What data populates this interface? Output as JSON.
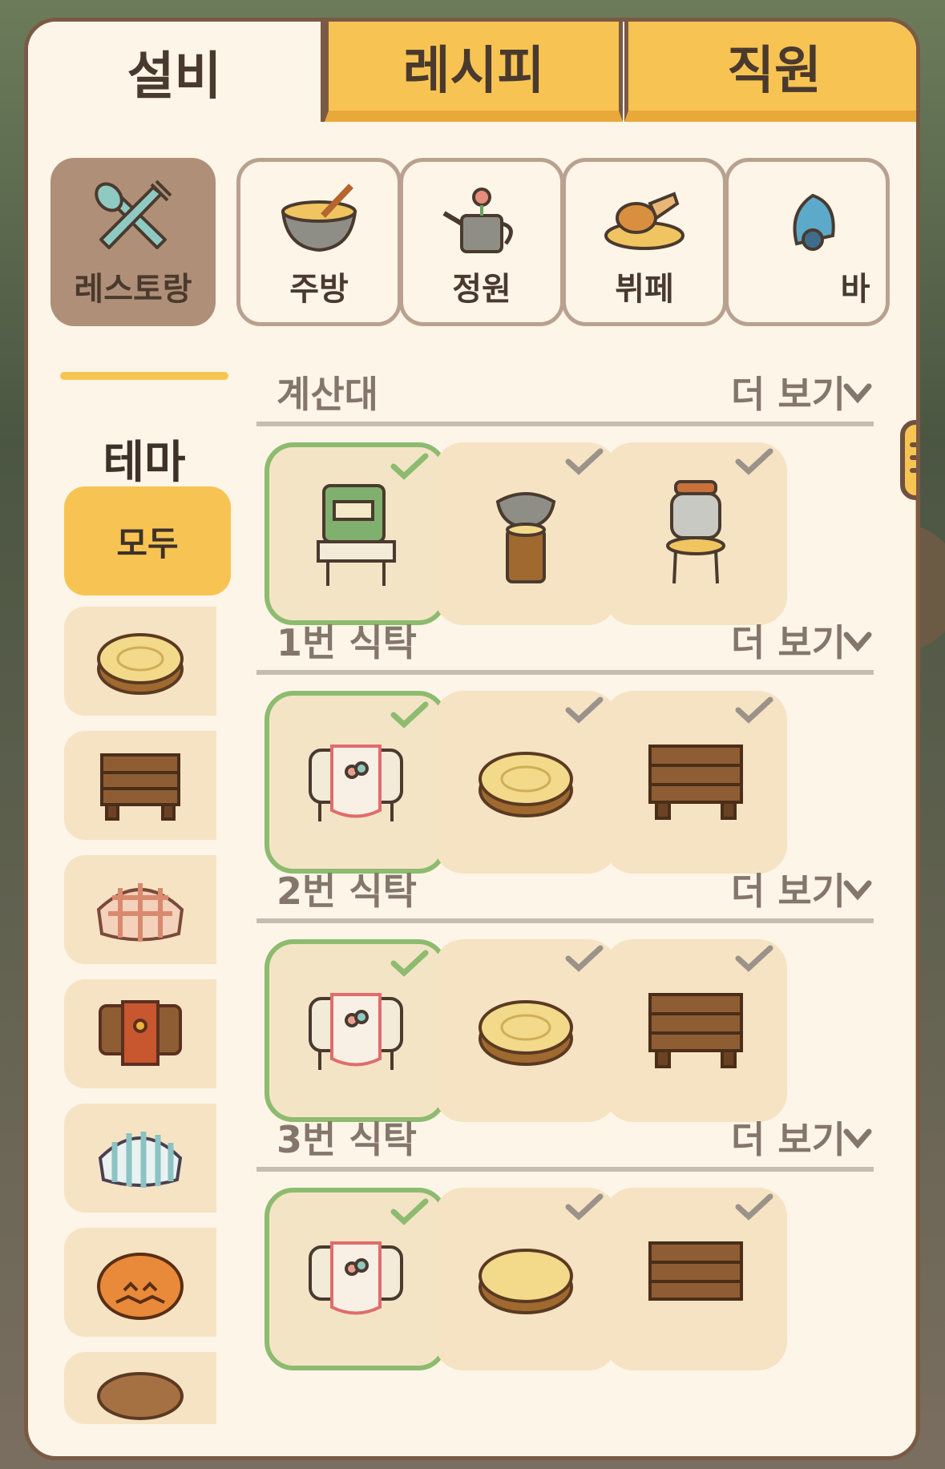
{
  "tabs": [
    {
      "label": "설비",
      "active": true
    },
    {
      "label": "레시피",
      "active": false
    },
    {
      "label": "직원",
      "active": false
    }
  ],
  "categories": [
    {
      "label": "레스토랑",
      "icon": "utensils-icon",
      "active": true
    },
    {
      "label": "주방",
      "icon": "mixing-bowl-icon",
      "active": false
    },
    {
      "label": "정원",
      "icon": "watering-can-icon",
      "active": false
    },
    {
      "label": "뷔페",
      "icon": "food-plate-icon",
      "active": false
    },
    {
      "label": "바",
      "icon": "bar-icon",
      "active": false
    }
  ],
  "theme": {
    "label": "테마",
    "all_label": "모두",
    "items": [
      "stump-table-icon",
      "wooden-table-icon",
      "gingham-table-icon",
      "paw-rug-table-icon",
      "striped-table-icon",
      "pumpkin-icon",
      "round-wood-table-icon"
    ]
  },
  "sections": [
    {
      "title": "계산대",
      "more": "더 보기",
      "items": [
        "cash-register-icon",
        "bowl-stump-icon",
        "jar-stool-icon"
      ],
      "selected": 0
    },
    {
      "title": "1번 식탁",
      "more": "더 보기",
      "items": [
        "flower-cloth-table-icon",
        "stump-table-icon",
        "wooden-table-icon"
      ],
      "selected": 0
    },
    {
      "title": "2번 식탁",
      "more": "더 보기",
      "items": [
        "flower-cloth-table-icon",
        "stump-table-icon",
        "wooden-table-icon"
      ],
      "selected": 0
    },
    {
      "title": "3번 식탁",
      "more": "더 보기",
      "items": [
        "flower-cloth-table-icon",
        "stump-table-icon",
        "wooden-table-icon"
      ],
      "selected": 0
    }
  ],
  "colors": {
    "accent": "#f7c453",
    "border": "#7b5a45",
    "selected": "#8dbb6f",
    "panel": "#fcf5e8"
  }
}
